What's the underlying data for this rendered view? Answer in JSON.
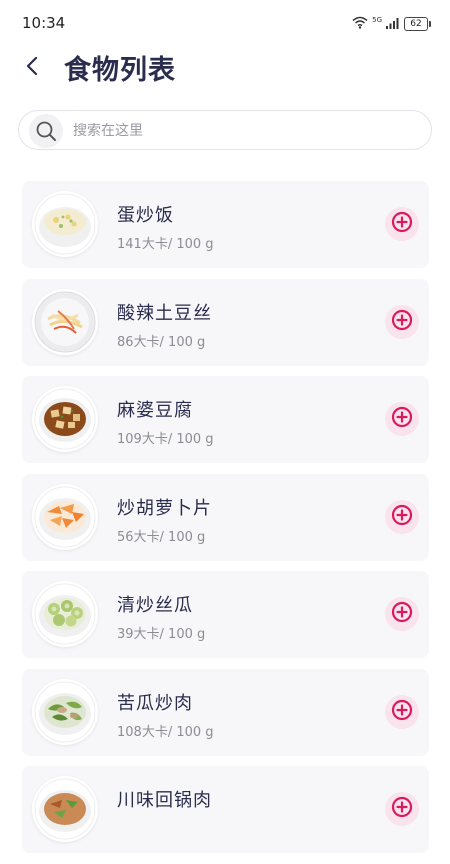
{
  "status_bar": {
    "time": "10:34",
    "network": "5G",
    "battery": "62",
    "icons": [
      "wifi-icon",
      "signal-icon",
      "battery-icon"
    ]
  },
  "header": {
    "back_icon": "chevron-left-icon",
    "title": "食物列表"
  },
  "search": {
    "icon": "search-icon",
    "placeholder": "搜索在这里"
  },
  "colors": {
    "accent": "#d81b60",
    "title": "#2a2d4e",
    "card_bg": "#f7f7f9",
    "add_bg": "#f9e3ec"
  },
  "foods": [
    {
      "name": "蛋炒饭",
      "calories": "141大卡/ 100 g"
    },
    {
      "name": "酸辣土豆丝",
      "calories": "86大卡/ 100 g"
    },
    {
      "name": "麻婆豆腐",
      "calories": "109大卡/ 100 g"
    },
    {
      "name": "炒胡萝卜片",
      "calories": "56大卡/ 100 g"
    },
    {
      "name": "清炒丝瓜",
      "calories": "39大卡/ 100 g"
    },
    {
      "name": "苦瓜炒肉",
      "calories": "108大卡/ 100 g"
    },
    {
      "name": "川味回锅肉",
      "calories": ""
    }
  ]
}
